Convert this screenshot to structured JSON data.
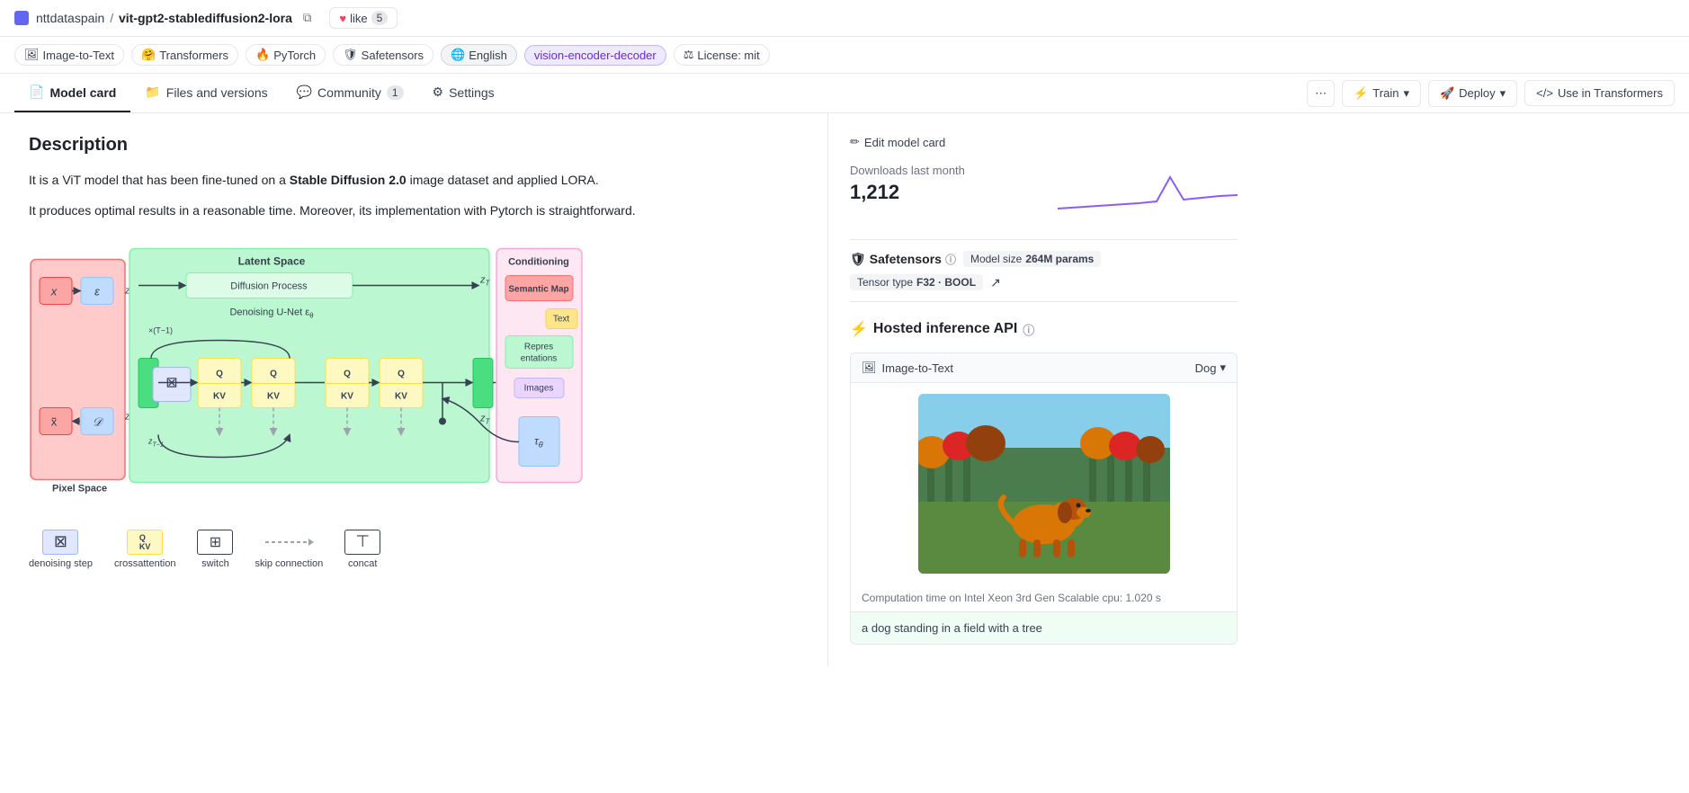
{
  "header": {
    "org": "nttdataspain",
    "separator": "/",
    "repo_name": "vit-gpt2-stablediffusion2-lora",
    "like_label": "like",
    "like_count": "5"
  },
  "tags": [
    {
      "id": "image-to-text",
      "icon": "🖼",
      "label": "Image-to-Text"
    },
    {
      "id": "transformers",
      "icon": "🤗",
      "label": "Transformers"
    },
    {
      "id": "pytorch",
      "icon": "🔥",
      "label": "PyTorch"
    },
    {
      "id": "safetensors",
      "icon": "🛡",
      "label": "Safetensors"
    },
    {
      "id": "english",
      "icon": "🌐",
      "label": "English",
      "highlighted": true
    },
    {
      "id": "vision-encoder-decoder",
      "label": "vision-encoder-decoder",
      "violet": true
    },
    {
      "id": "license",
      "icon": "⚖",
      "label": "License: mit"
    }
  ],
  "nav": {
    "tabs": [
      {
        "id": "model-card",
        "label": "Model card",
        "icon": "📄",
        "active": true
      },
      {
        "id": "files-versions",
        "label": "Files and versions",
        "icon": "📁"
      },
      {
        "id": "community",
        "label": "Community",
        "icon": "💬",
        "badge": "1"
      },
      {
        "id": "settings",
        "label": "Settings",
        "icon": "⚙"
      }
    ],
    "actions": {
      "dots": "⋯",
      "train": "Train",
      "deploy": "Deploy",
      "use_in_transformers": "Use in Transformers"
    }
  },
  "content": {
    "edit_link": "Edit model card",
    "description_title": "Description",
    "paragraph1_pre": "It is a ViT model that has been fine-tuned on a ",
    "paragraph1_bold": "Stable Diffusion 2.0",
    "paragraph1_post": " image dataset and applied LORA.",
    "paragraph2": "It produces optimal results in a reasonable time. Moreover, its implementation with Pytorch is straightforward."
  },
  "sidebar": {
    "downloads_label": "Downloads last month",
    "downloads_count": "1,212",
    "safetensors_label": "Safetensors",
    "model_size_label": "Model size",
    "model_size_value": "264M params",
    "tensor_type_label": "Tensor type",
    "tensor_type_value": "F32 · BOOL",
    "inference_title": "Hosted inference API",
    "inference_type": "Image-to-Text",
    "inference_select": "Dog",
    "compute_time": "Computation time on Intel Xeon 3rd Gen Scalable cpu: 1.020 s",
    "output_text": "a dog standing in a field with a tree"
  },
  "legend": {
    "items": [
      {
        "id": "denoising-step",
        "label": "denoising step",
        "bg": "#e0e7ff",
        "text": "⊠"
      },
      {
        "id": "crossattention",
        "label": "crossattention",
        "bg": "#fef3c7",
        "text": "Q KV"
      },
      {
        "id": "switch",
        "label": "switch",
        "bg": "#ffffff",
        "text": "⊡",
        "border": "#6b7280"
      },
      {
        "id": "skip-connection",
        "label": "skip connection",
        "bg": "#ffffff",
        "text": "- - →",
        "dashed": true
      },
      {
        "id": "concat",
        "label": "concat",
        "bg": "#ffffff",
        "text": "⊤"
      }
    ]
  }
}
